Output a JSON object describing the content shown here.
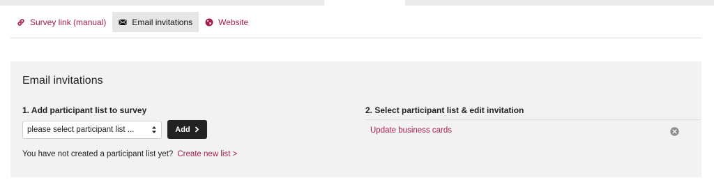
{
  "tabs": [
    {
      "label": "Survey link (manual)",
      "icon": "link-icon"
    },
    {
      "label": "Email invitations",
      "icon": "envelope-icon"
    },
    {
      "label": "Website",
      "icon": "globe-icon"
    }
  ],
  "colors": {
    "accent": "#a51d4f",
    "panel_bg": "#f2f2f2",
    "active_tab_bg": "#e6e6e6",
    "button_bg": "#222222"
  },
  "panel": {
    "title": "Email invitations",
    "step1": {
      "heading": "1. Add participant list to survey",
      "select_value": "please select participant list ...",
      "add_label": "Add",
      "note": "You have not created a participant list yet?",
      "create_link": "Create new list >"
    },
    "step2": {
      "heading": "2. Select participant list & edit invitation",
      "items": [
        {
          "label": "Update business cards"
        }
      ]
    }
  }
}
